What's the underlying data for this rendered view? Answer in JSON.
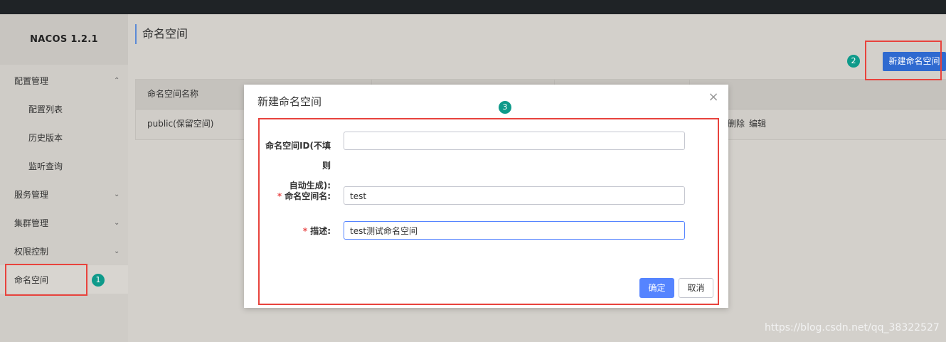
{
  "brand": "NACOS 1.2.1",
  "sidebar": {
    "items": [
      {
        "label": "配置管理",
        "chevron": "^"
      },
      {
        "label": "配置列表"
      },
      {
        "label": "历史版本"
      },
      {
        "label": "监听查询"
      },
      {
        "label": "服务管理",
        "chevron": "v"
      },
      {
        "label": "集群管理",
        "chevron": "v"
      },
      {
        "label": "权限控制",
        "chevron": "v"
      },
      {
        "label": "命名空间"
      }
    ]
  },
  "page": {
    "title": "命名空间",
    "new_button": "新建命名空间"
  },
  "table": {
    "headers": [
      "命名空间名称"
    ],
    "rows": [
      {
        "name": "public(保留空间)",
        "actions": [
          "删除",
          "编辑"
        ]
      }
    ]
  },
  "dialog": {
    "title": "新建命名空间",
    "fields": [
      {
        "label_line1": "命名空间ID(不填则",
        "label_line2": "自动生成):",
        "value": "",
        "required": false
      },
      {
        "label": "命名空间名:",
        "value": "test",
        "required": true
      },
      {
        "label": "描述:",
        "value": "test测试命名空间",
        "required": true
      }
    ],
    "ok_label": "确定",
    "cancel_label": "取消",
    "required_mark": "*"
  },
  "annotations": {
    "steps": [
      "1",
      "2",
      "3"
    ],
    "highlight_color": "#e8433d",
    "step_color": "#0e9a8a"
  },
  "watermark": "https://blog.csdn.net/qq_38322527",
  "colors": {
    "primary_button": "#2f6ad0",
    "dialog_ok": "#5584ff"
  }
}
